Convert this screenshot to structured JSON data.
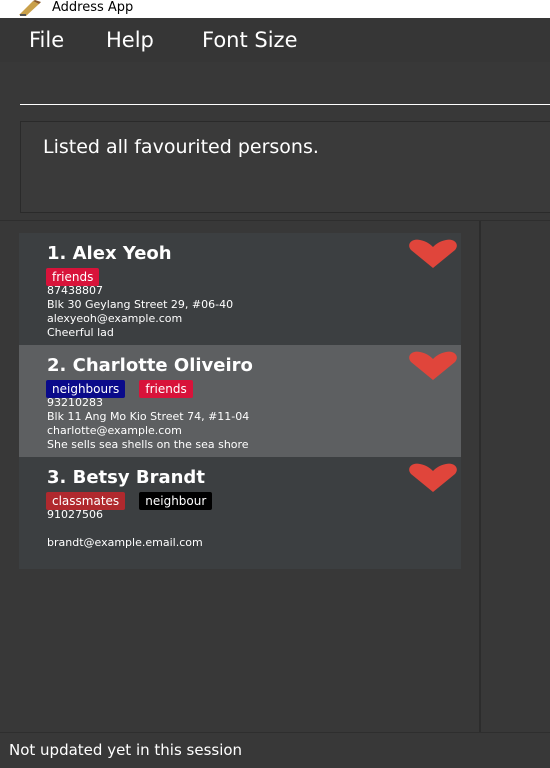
{
  "window": {
    "title": "Address App",
    "icon": "address-book-icon"
  },
  "menu": {
    "file": "File",
    "help": "Help",
    "font_size": "Font Size"
  },
  "command": {
    "value": "",
    "placeholder": ""
  },
  "result": {
    "message": "Listed all favourited persons."
  },
  "persons": [
    {
      "index_name": "1.  Alex Yeoh",
      "tags": [
        {
          "label": "friends",
          "color": "#d8133a"
        }
      ],
      "phone": "87438807",
      "address": "Blk 30 Geylang Street 29, #06-40",
      "email": "alexyeoh@example.com",
      "remark": "Cheerful lad",
      "favourite": true,
      "favourite_icon": "heart-icon"
    },
    {
      "index_name": "2.  Charlotte Oliveiro",
      "tags": [
        {
          "label": "neighbours",
          "color": "#0a0a8a"
        },
        {
          "label": "friends",
          "color": "#d8133a"
        }
      ],
      "phone": "93210283",
      "address": "Blk 11 Ang Mo Kio Street 74, #11-04",
      "email": "charlotte@example.com",
      "remark": "She sells sea shells on the sea shore",
      "favourite": true,
      "favourite_icon": "heart-icon"
    },
    {
      "index_name": "3.  Betsy Brandt",
      "tags": [
        {
          "label": "classmates",
          "color": "#b0292e"
        },
        {
          "label": "neighbour",
          "color": "#000000"
        }
      ],
      "phone": "91027506",
      "address": "",
      "email": "brandt@example.email.com",
      "remark": "",
      "favourite": true,
      "favourite_icon": "heart-icon"
    }
  ],
  "status": {
    "text": "Not updated yet in this session"
  },
  "colors": {
    "background": "#383838",
    "card": "#3c3f41",
    "card_selected": "#5d5f61",
    "heart": "#e0453b"
  }
}
